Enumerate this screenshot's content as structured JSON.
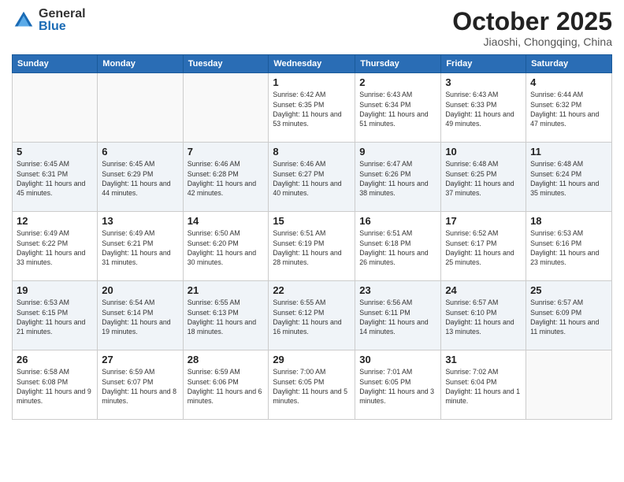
{
  "logo": {
    "general": "General",
    "blue": "Blue"
  },
  "title": "October 2025",
  "subtitle": "Jiaoshi, Chongqing, China",
  "headers": [
    "Sunday",
    "Monday",
    "Tuesday",
    "Wednesday",
    "Thursday",
    "Friday",
    "Saturday"
  ],
  "weeks": [
    [
      null,
      null,
      null,
      {
        "day": "1",
        "rise": "Sunrise: 6:42 AM",
        "set": "Sunset: 6:35 PM",
        "daylight": "Daylight: 11 hours and 53 minutes."
      },
      {
        "day": "2",
        "rise": "Sunrise: 6:43 AM",
        "set": "Sunset: 6:34 PM",
        "daylight": "Daylight: 11 hours and 51 minutes."
      },
      {
        "day": "3",
        "rise": "Sunrise: 6:43 AM",
        "set": "Sunset: 6:33 PM",
        "daylight": "Daylight: 11 hours and 49 minutes."
      },
      {
        "day": "4",
        "rise": "Sunrise: 6:44 AM",
        "set": "Sunset: 6:32 PM",
        "daylight": "Daylight: 11 hours and 47 minutes."
      }
    ],
    [
      {
        "day": "5",
        "rise": "Sunrise: 6:45 AM",
        "set": "Sunset: 6:31 PM",
        "daylight": "Daylight: 11 hours and 45 minutes."
      },
      {
        "day": "6",
        "rise": "Sunrise: 6:45 AM",
        "set": "Sunset: 6:29 PM",
        "daylight": "Daylight: 11 hours and 44 minutes."
      },
      {
        "day": "7",
        "rise": "Sunrise: 6:46 AM",
        "set": "Sunset: 6:28 PM",
        "daylight": "Daylight: 11 hours and 42 minutes."
      },
      {
        "day": "8",
        "rise": "Sunrise: 6:46 AM",
        "set": "Sunset: 6:27 PM",
        "daylight": "Daylight: 11 hours and 40 minutes."
      },
      {
        "day": "9",
        "rise": "Sunrise: 6:47 AM",
        "set": "Sunset: 6:26 PM",
        "daylight": "Daylight: 11 hours and 38 minutes."
      },
      {
        "day": "10",
        "rise": "Sunrise: 6:48 AM",
        "set": "Sunset: 6:25 PM",
        "daylight": "Daylight: 11 hours and 37 minutes."
      },
      {
        "day": "11",
        "rise": "Sunrise: 6:48 AM",
        "set": "Sunset: 6:24 PM",
        "daylight": "Daylight: 11 hours and 35 minutes."
      }
    ],
    [
      {
        "day": "12",
        "rise": "Sunrise: 6:49 AM",
        "set": "Sunset: 6:22 PM",
        "daylight": "Daylight: 11 hours and 33 minutes."
      },
      {
        "day": "13",
        "rise": "Sunrise: 6:49 AM",
        "set": "Sunset: 6:21 PM",
        "daylight": "Daylight: 11 hours and 31 minutes."
      },
      {
        "day": "14",
        "rise": "Sunrise: 6:50 AM",
        "set": "Sunset: 6:20 PM",
        "daylight": "Daylight: 11 hours and 30 minutes."
      },
      {
        "day": "15",
        "rise": "Sunrise: 6:51 AM",
        "set": "Sunset: 6:19 PM",
        "daylight": "Daylight: 11 hours and 28 minutes."
      },
      {
        "day": "16",
        "rise": "Sunrise: 6:51 AM",
        "set": "Sunset: 6:18 PM",
        "daylight": "Daylight: 11 hours and 26 minutes."
      },
      {
        "day": "17",
        "rise": "Sunrise: 6:52 AM",
        "set": "Sunset: 6:17 PM",
        "daylight": "Daylight: 11 hours and 25 minutes."
      },
      {
        "day": "18",
        "rise": "Sunrise: 6:53 AM",
        "set": "Sunset: 6:16 PM",
        "daylight": "Daylight: 11 hours and 23 minutes."
      }
    ],
    [
      {
        "day": "19",
        "rise": "Sunrise: 6:53 AM",
        "set": "Sunset: 6:15 PM",
        "daylight": "Daylight: 11 hours and 21 minutes."
      },
      {
        "day": "20",
        "rise": "Sunrise: 6:54 AM",
        "set": "Sunset: 6:14 PM",
        "daylight": "Daylight: 11 hours and 19 minutes."
      },
      {
        "day": "21",
        "rise": "Sunrise: 6:55 AM",
        "set": "Sunset: 6:13 PM",
        "daylight": "Daylight: 11 hours and 18 minutes."
      },
      {
        "day": "22",
        "rise": "Sunrise: 6:55 AM",
        "set": "Sunset: 6:12 PM",
        "daylight": "Daylight: 11 hours and 16 minutes."
      },
      {
        "day": "23",
        "rise": "Sunrise: 6:56 AM",
        "set": "Sunset: 6:11 PM",
        "daylight": "Daylight: 11 hours and 14 minutes."
      },
      {
        "day": "24",
        "rise": "Sunrise: 6:57 AM",
        "set": "Sunset: 6:10 PM",
        "daylight": "Daylight: 11 hours and 13 minutes."
      },
      {
        "day": "25",
        "rise": "Sunrise: 6:57 AM",
        "set": "Sunset: 6:09 PM",
        "daylight": "Daylight: 11 hours and 11 minutes."
      }
    ],
    [
      {
        "day": "26",
        "rise": "Sunrise: 6:58 AM",
        "set": "Sunset: 6:08 PM",
        "daylight": "Daylight: 11 hours and 9 minutes."
      },
      {
        "day": "27",
        "rise": "Sunrise: 6:59 AM",
        "set": "Sunset: 6:07 PM",
        "daylight": "Daylight: 11 hours and 8 minutes."
      },
      {
        "day": "28",
        "rise": "Sunrise: 6:59 AM",
        "set": "Sunset: 6:06 PM",
        "daylight": "Daylight: 11 hours and 6 minutes."
      },
      {
        "day": "29",
        "rise": "Sunrise: 7:00 AM",
        "set": "Sunset: 6:05 PM",
        "daylight": "Daylight: 11 hours and 5 minutes."
      },
      {
        "day": "30",
        "rise": "Sunrise: 7:01 AM",
        "set": "Sunset: 6:05 PM",
        "daylight": "Daylight: 11 hours and 3 minutes."
      },
      {
        "day": "31",
        "rise": "Sunrise: 7:02 AM",
        "set": "Sunset: 6:04 PM",
        "daylight": "Daylight: 11 hours and 1 minute."
      },
      null
    ]
  ]
}
